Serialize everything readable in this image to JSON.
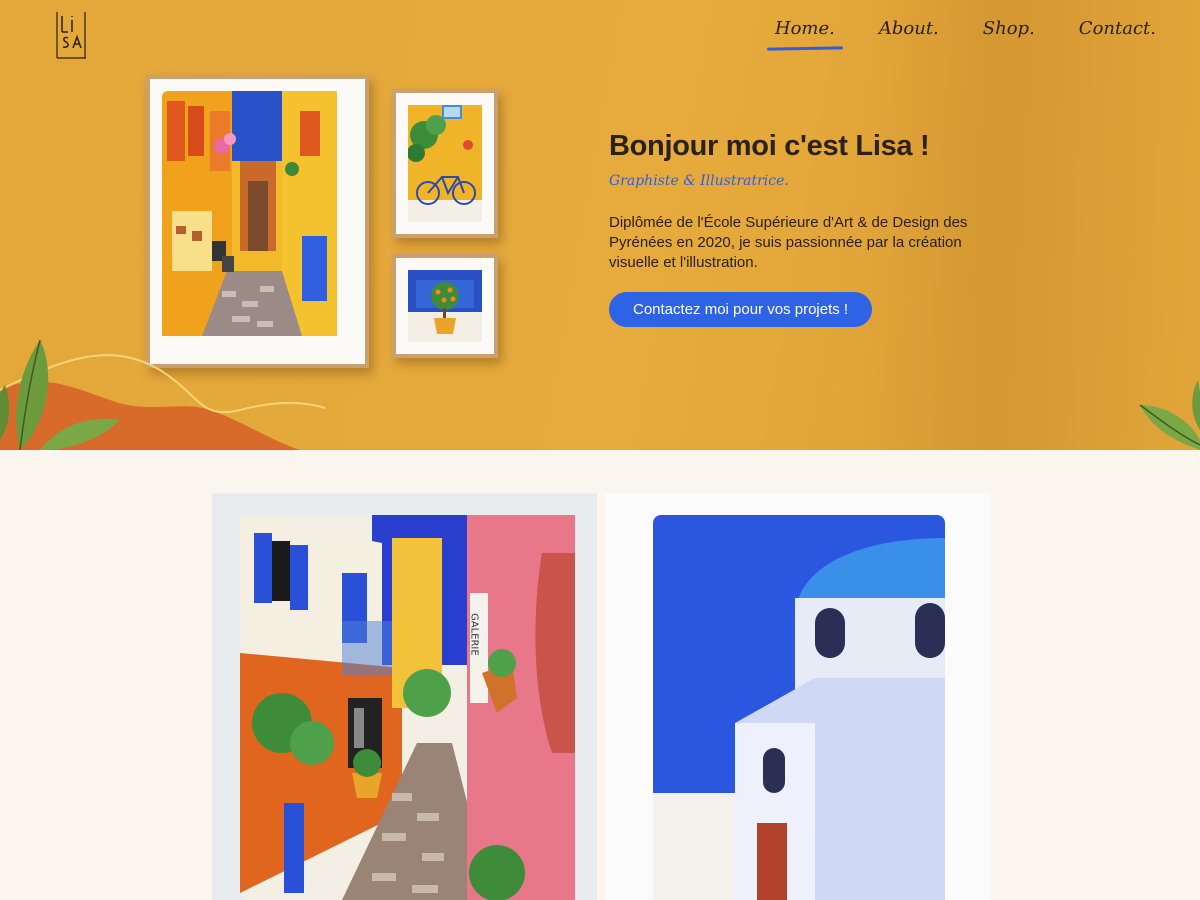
{
  "brand": {
    "logo_text": "LiSA"
  },
  "nav": {
    "items": [
      {
        "label": "Home.",
        "active": true
      },
      {
        "label": "About.",
        "active": false
      },
      {
        "label": "Shop.",
        "active": false
      },
      {
        "label": "Contact.",
        "active": false
      }
    ]
  },
  "hero": {
    "title": "Bonjour moi c'est Lisa !",
    "subtitle": "Graphiste & Illustratrice.",
    "description": "Diplômée de l'École Supérieure d'Art & de Design des Pyrénées en 2020, je suis passionnée par la création visuelle et l'illustration.",
    "cta_label": "Contactez moi pour vos projets !",
    "background_color": "#e4a83b"
  },
  "gallery": {
    "items": [
      {
        "name": "street-with-gallery-illustration",
        "sign_text": "GALERIE"
      },
      {
        "name": "white-house-blue-dome-illustration"
      }
    ]
  },
  "colors": {
    "accent": "#2f63e6",
    "text": "#2a2119",
    "page_bg": "#faf6ee"
  }
}
